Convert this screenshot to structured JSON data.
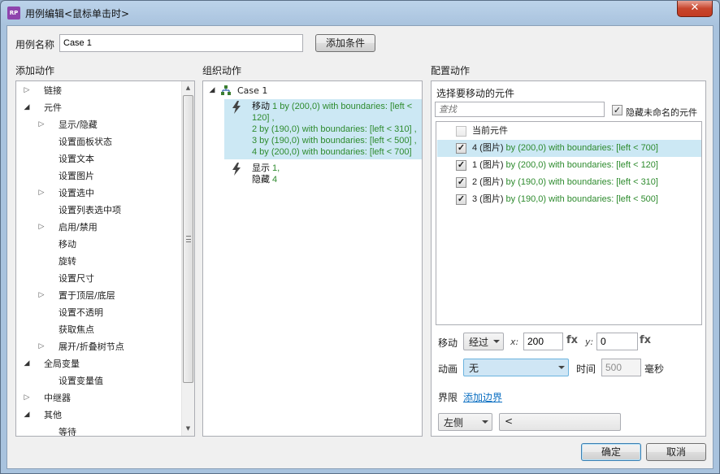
{
  "window": {
    "title": "用例编辑<鼠标单击时>",
    "app_badge": "RP",
    "close_glyph": "✕"
  },
  "case_name": {
    "label": "用例名称",
    "value": "Case 1"
  },
  "add_condition_label": "添加条件",
  "sections": {
    "add_actions": "添加动作",
    "organize_actions": "组织动作",
    "configure_actions": "配置动作"
  },
  "add_actions_tree": [
    {
      "label": "链接",
      "level": 0,
      "state": "collapsed"
    },
    {
      "label": "元件",
      "level": 0,
      "state": "expanded"
    },
    {
      "label": "显示/隐藏",
      "level": 1,
      "state": "collapsed"
    },
    {
      "label": "设置面板状态",
      "level": 1,
      "state": "leaf"
    },
    {
      "label": "设置文本",
      "level": 1,
      "state": "leaf"
    },
    {
      "label": "设置图片",
      "level": 1,
      "state": "leaf"
    },
    {
      "label": "设置选中",
      "level": 1,
      "state": "collapsed"
    },
    {
      "label": "设置列表选中项",
      "level": 1,
      "state": "leaf"
    },
    {
      "label": "启用/禁用",
      "level": 1,
      "state": "collapsed"
    },
    {
      "label": "移动",
      "level": 1,
      "state": "leaf"
    },
    {
      "label": "旋转",
      "level": 1,
      "state": "leaf"
    },
    {
      "label": "设置尺寸",
      "level": 1,
      "state": "leaf"
    },
    {
      "label": "置于顶层/底层",
      "level": 1,
      "state": "collapsed"
    },
    {
      "label": "设置不透明",
      "level": 1,
      "state": "leaf"
    },
    {
      "label": "获取焦点",
      "level": 1,
      "state": "leaf"
    },
    {
      "label": "展开/折叠树节点",
      "level": 1,
      "state": "collapsed"
    },
    {
      "label": "全局变量",
      "level": 0,
      "state": "expanded"
    },
    {
      "label": "设置变量值",
      "level": 1,
      "state": "leaf"
    },
    {
      "label": "中继器",
      "level": 0,
      "state": "collapsed"
    },
    {
      "label": "其他",
      "level": 0,
      "state": "expanded"
    },
    {
      "label": "等待",
      "level": 1,
      "state": "leaf"
    }
  ],
  "organize": {
    "case_label": "Case 1",
    "actions": [
      {
        "selected": true,
        "lines": [
          {
            "verb": "移动",
            "arg": " 1 by (200,0) with boundaries: [left <"
          },
          {
            "verb": "",
            "arg": "120] ,"
          },
          {
            "verb": "",
            "arg": "2 by (190,0) with boundaries: [left < 310] ,"
          },
          {
            "verb": "",
            "arg": "3 by (190,0) with boundaries: [left < 500] ,"
          },
          {
            "verb": "",
            "arg": "4 by (200,0) with boundaries: [left < 700]"
          }
        ]
      },
      {
        "selected": false,
        "lines": [
          {
            "verb": "显示",
            "arg": " 1,"
          },
          {
            "verb": "隐藏",
            "arg": " 4"
          }
        ]
      }
    ]
  },
  "configure": {
    "select_label": "选择要移动的元件",
    "search_placeholder": "查找",
    "hide_unnamed": {
      "label": "隐藏未命名的元件",
      "checked": true
    },
    "widgets": [
      {
        "name": "当前元件",
        "detail": "",
        "checked": false,
        "selected": false,
        "disabled": true
      },
      {
        "name": "4 (图片)",
        "detail": " by (200,0) with boundaries: [left < 700]",
        "checked": true,
        "selected": true,
        "disabled": false
      },
      {
        "name": "1 (图片)",
        "detail": " by (200,0) with boundaries: [left < 120]",
        "checked": true,
        "selected": false,
        "disabled": false
      },
      {
        "name": "2 (图片)",
        "detail": " by (190,0) with boundaries: [left < 310]",
        "checked": true,
        "selected": false,
        "disabled": false
      },
      {
        "name": "3 (图片)",
        "detail": " by (190,0) with boundaries: [left < 500]",
        "checked": true,
        "selected": false,
        "disabled": false
      }
    ],
    "move": {
      "label": "移动",
      "mode": "经过",
      "x_label": "x:",
      "x_value": "200",
      "y_label": "y:",
      "y_value": "0",
      "fx": "fx"
    },
    "animation": {
      "label": "动画",
      "value": "无",
      "time_label": "时间",
      "time_value": "500",
      "time_unit": "毫秒"
    },
    "boundary": {
      "label": "界限",
      "add_link": "添加边界",
      "side": "左侧",
      "operator": "<"
    }
  },
  "footer": {
    "ok": "确定",
    "cancel": "取消"
  },
  "icons": {
    "tree_collapsed": "▷",
    "tree_expanded": "◢",
    "check": "✓",
    "scroll_up": "▲",
    "scroll_down": "▼"
  },
  "colors": {
    "selection": "#cce8f4",
    "argument_text": "#2e8b2e",
    "link": "#0b6fc2"
  }
}
